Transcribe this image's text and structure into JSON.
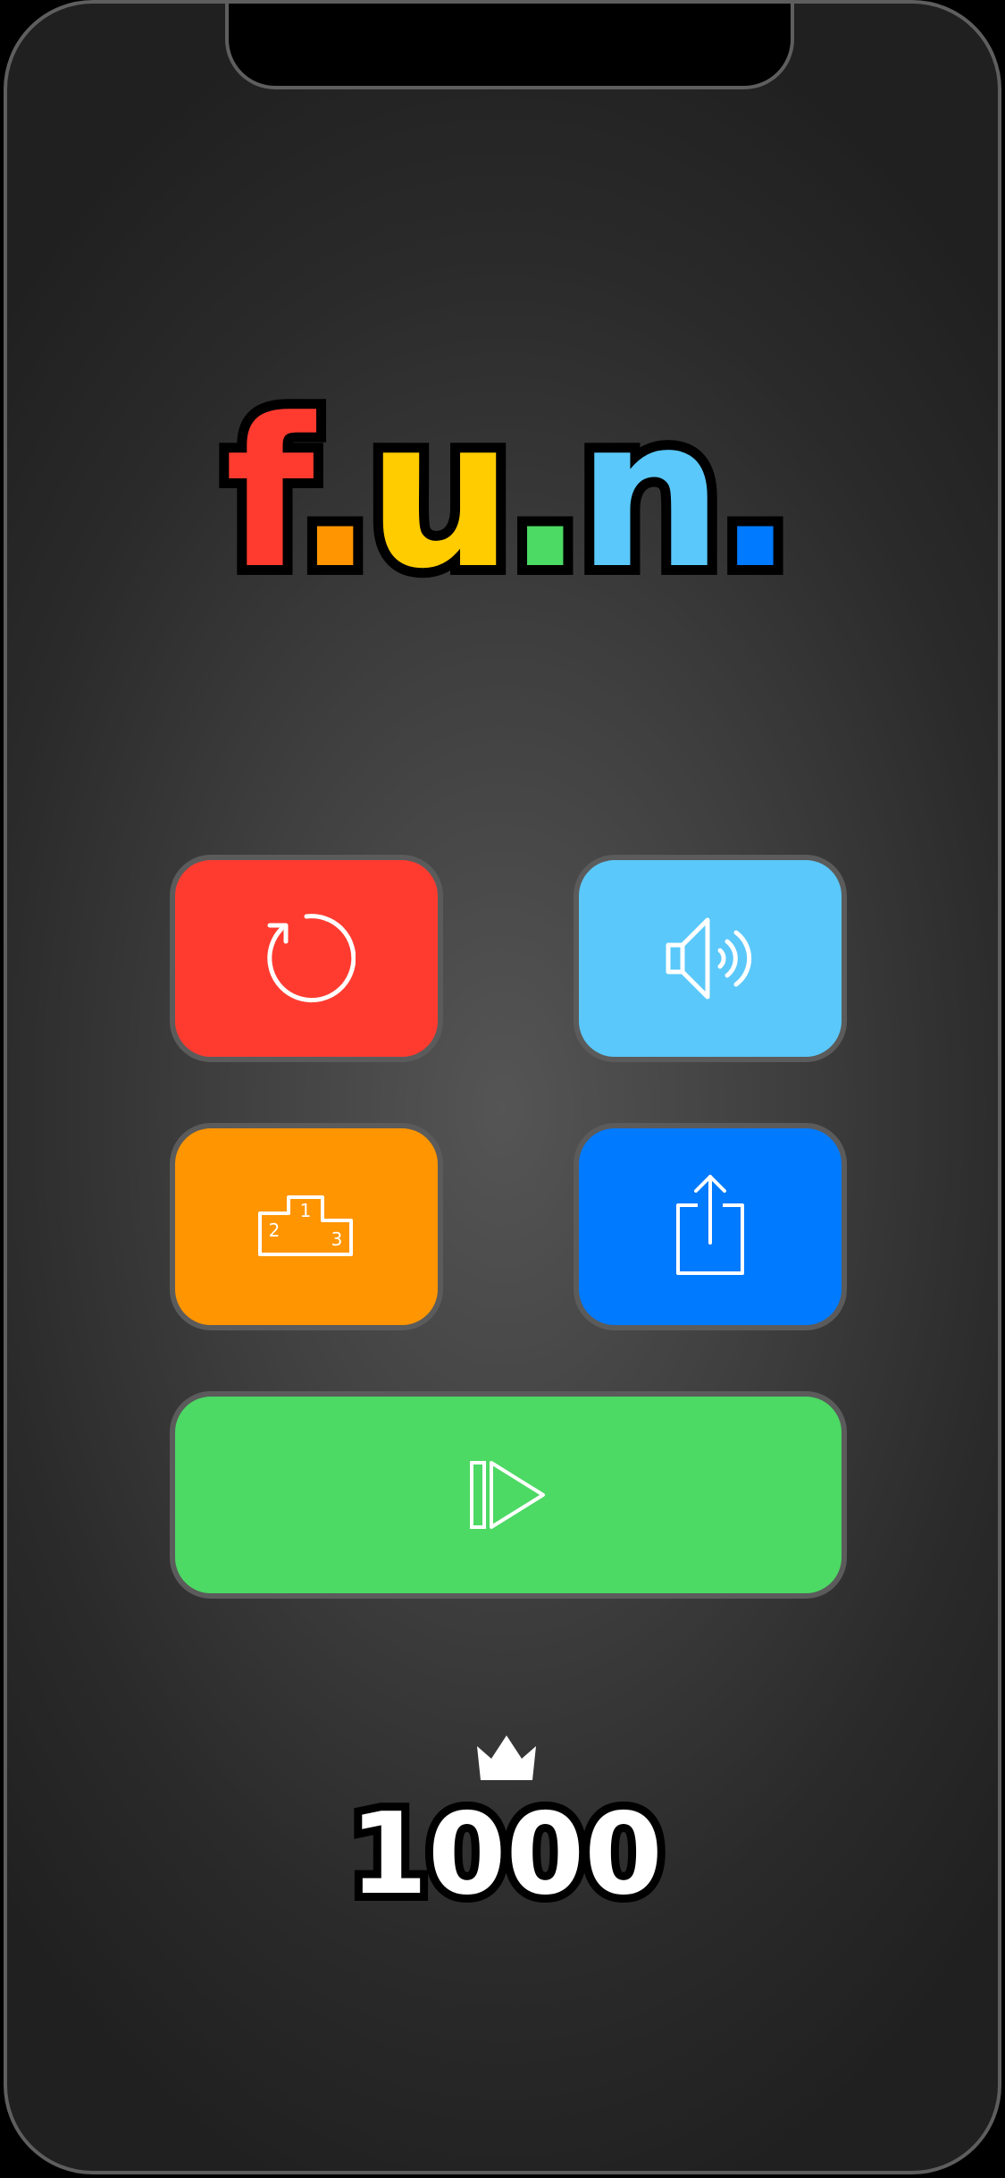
{
  "title": {
    "letters": [
      {
        "char": "f",
        "color": "#ff3b30"
      },
      {
        "char": ".",
        "color": "#ff9500"
      },
      {
        "char": "u",
        "color": "#ffcc00"
      },
      {
        "char": ".",
        "color": "#4cd964"
      },
      {
        "char": "n",
        "color": "#5ac8fa"
      },
      {
        "char": ".",
        "color": "#007aff"
      }
    ]
  },
  "buttons": {
    "restart": {
      "color": "#ff3b30",
      "icon": "restart-icon"
    },
    "sound": {
      "color": "#5ac8fa",
      "icon": "speaker-icon"
    },
    "leaderboard": {
      "color": "#ff9500",
      "icon": "podium-icon",
      "podium_labels": [
        "1",
        "2",
        "3"
      ]
    },
    "share": {
      "color": "#007aff",
      "icon": "share-icon"
    },
    "play": {
      "color": "#4cd964",
      "icon": "resume-icon"
    }
  },
  "best_score": {
    "icon": "crown-icon",
    "value": "1000"
  }
}
